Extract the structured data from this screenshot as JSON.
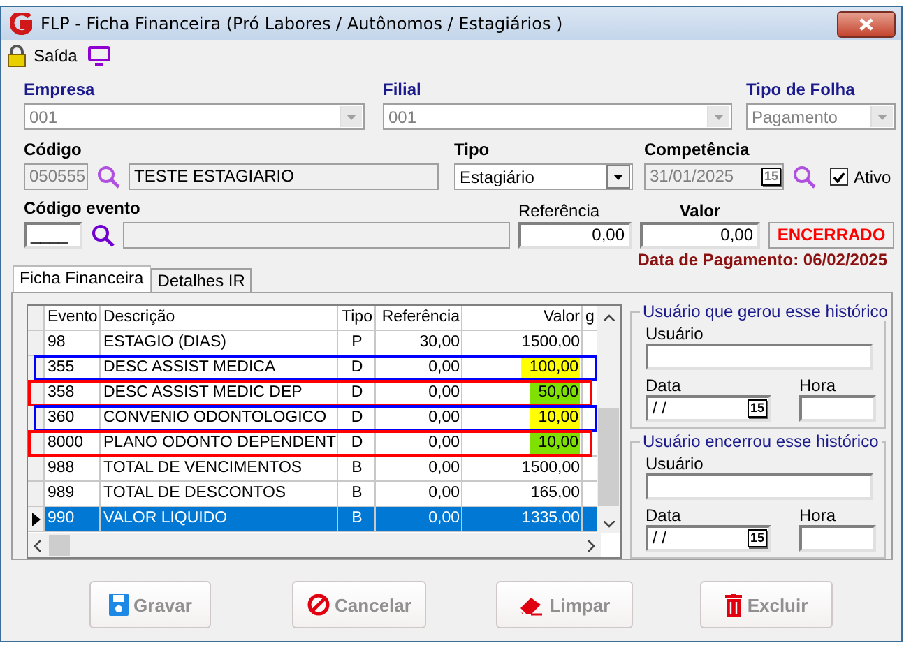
{
  "window": {
    "title": "FLP - Ficha Financeira (Pró Labores / Autônomos / Estagiários )"
  },
  "toolbar": [
    {
      "kind": "lock",
      "label": "Saída"
    },
    {
      "kind": "monitor"
    }
  ],
  "empresa": {
    "label": "Empresa",
    "value": "001",
    "disabled": true
  },
  "filial": {
    "label": "Filial",
    "value": "001",
    "disabled": true
  },
  "tipo_folha": {
    "label": "Tipo de Folha",
    "value": "Pagamento",
    "disabled": true
  },
  "codigo": {
    "label": "Código",
    "value": "050555",
    "disabled": true,
    "name": "TESTE ESTAGIARIO"
  },
  "tipo": {
    "label": "Tipo",
    "value": "Estagiário",
    "disabled": false
  },
  "competencia": {
    "label": "Competência",
    "value": "31/01/2025",
    "disabled": true,
    "button": "15"
  },
  "ativo": {
    "label": "Ativo",
    "checked": true
  },
  "codigo_evento": {
    "label": "Código evento",
    "value": "____"
  },
  "referencia": {
    "label": "Referência",
    "value": "0,00"
  },
  "valor": {
    "label": "Valor",
    "value": "0,00"
  },
  "status": "ENCERRADO",
  "data_pagamento": "Data de Pagamento: 06/02/2025",
  "tabs": [
    {
      "label": "Ficha Financeira",
      "selected": true
    },
    {
      "label": "Detalhes IR",
      "selected": false
    }
  ],
  "table": {
    "columns": [
      "Evento",
      "Descrição",
      "Tipo",
      "Referência",
      "Valor",
      "g"
    ],
    "rows": [
      {
        "cells": [
          "98",
          "ESTAGIO (DIAS)",
          "P",
          "30,00",
          "1500,00"
        ],
        "selected": false
      },
      {
        "cells": [
          "355",
          "DESC ASSIST MEDICA",
          "D",
          "0,00",
          "100,00"
        ],
        "selected": false,
        "color": "#ffff00",
        "annotation": {
          "color": "#0000ff"
        }
      },
      {
        "cells": [
          "358",
          "DESC ASSIST MEDIC DEP",
          "D",
          "0,00",
          "50,00"
        ],
        "selected": false,
        "color": "#80e000",
        "annotation": {
          "color": "#ff0000"
        }
      },
      {
        "cells": [
          "360",
          "CONVENIO ODONTOLOGICO",
          "D",
          "0,00",
          "10,00"
        ],
        "selected": false,
        "color": "#ffff00",
        "annotation": {
          "color": "#0000ff"
        }
      },
      {
        "cells": [
          "8000",
          "PLANO ODONTO DEPENDENT",
          "D",
          "0,00",
          "10,00"
        ],
        "selected": false,
        "color": "#80e000",
        "annotation": {
          "color": "#ff0000"
        }
      },
      {
        "cells": [
          "988",
          "TOTAL DE VENCIMENTOS",
          "B",
          "0,00",
          "1500,00"
        ],
        "selected": false
      },
      {
        "cells": [
          "989",
          "TOTAL DE DESCONTOS",
          "B",
          "0,00",
          "165,00"
        ],
        "selected": false
      },
      {
        "cells": [
          "990",
          "VALOR LIQUIDO",
          "B",
          "0,00",
          "1335,00"
        ],
        "selected": true
      }
    ]
  },
  "history": [
    {
      "title": "Usuário que gerou esse histórico",
      "user_label": "Usuário",
      "date_label": "Data",
      "date_value": " / /",
      "button": "15",
      "time_label": "Hora"
    },
    {
      "title": "Usuário encerrou esse histórico",
      "user_label": "Usuário",
      "date_label": "Data",
      "date_value": " / /",
      "button": "15",
      "time_label": "Hora"
    }
  ],
  "buttons": [
    {
      "kind": "save",
      "label": "Gravar",
      "disabled": true
    },
    {
      "kind": "cancel",
      "label": "Cancelar",
      "disabled": true
    },
    {
      "kind": "eraser",
      "label": "Limpar",
      "disabled": true
    },
    {
      "kind": "trash",
      "label": "Excluir",
      "disabled": true
    }
  ]
}
